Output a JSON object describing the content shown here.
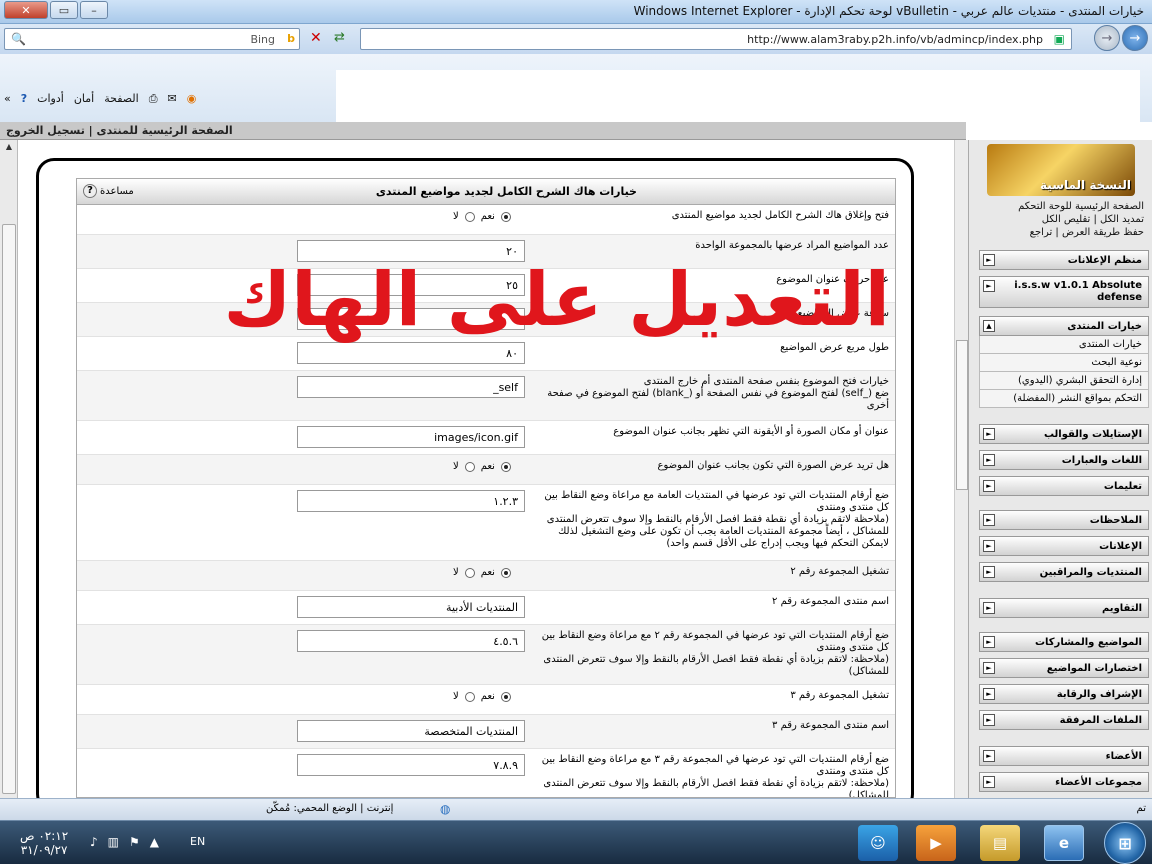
{
  "window": {
    "title": "خيارات المنتدى - منتديات عالم عربي - vBulletin لوحة تحكم الإدارة - Windows Internet Explorer"
  },
  "address": {
    "url": "http://www.alam3raby.p2h.info/vb/admincp/index.php",
    "search_provider": "Bing"
  },
  "toolbar": {
    "page_label": "الصفحة",
    "safety_label": "أمان",
    "tools_label": "أدوات"
  },
  "adminbar": {
    "home_label": "الصفحة الرئيسية للمنتدى",
    "separator": "|",
    "logout_label": "تسجيل الخروج"
  },
  "panel": {
    "title": "خيارات هاك الشرح الكامل لجديد مواضيع المنتدى",
    "help_label": "مساعدة",
    "yes_label": "نعم",
    "no_label": "لا",
    "rows": [
      {
        "label": "فتح وإغلاق هاك الشرح الكامل لجديد مواضيع المنتدى"
      },
      {
        "label": "عدد المواضيع المراد عرضها بالمجموعة الواحدة",
        "value": "٢٠"
      },
      {
        "label": "عدد حروف عنوان الموضوع",
        "value": "٢٥"
      },
      {
        "label": "سرعة عرض المواضيع",
        "value": "٢"
      },
      {
        "label": "طول مربع عرض المواضيع",
        "value": "٨٠"
      },
      {
        "label": "خيارات فتح الموضوع بنفس صفحة المنتدى أم خارج المنتدى",
        "help": "ضع (_self) لفتح الموضوع في نفس الصفحة أو (_blank) لفتح الموضوع في صفحة أخرى",
        "value": "_self"
      },
      {
        "label": "عنوان أو مكان الصورة أو الأيقونة التي تظهر بجانب عنوان الموضوع",
        "value": "images/icon.gif"
      },
      {
        "label": "هل تريد عرض الصورة التي تكون بجانب عنوان الموضوع"
      },
      {
        "label": "ضع أرقام المنتديات التي تود عرضها في المنتديات العامة مع مراعاة وضع النقاط بين كل منتدى ومنتدى",
        "help": "(ملاحظة لاتقم بزيادة أي نقطة فقط افصل الأرقام بالنقط وإلا سوف تتعرض المنتدى للمشاكل ، أيضاً مجموعة المنتديات العامة يجب أن تكون على وضع التشغيل لذلك لايمكن التحكم فيها ويجب إدراج على الأقل قسم واحد)",
        "value": "١.٢.٣"
      },
      {
        "label": "تشغيل المجموعة رقم ٢"
      },
      {
        "label": "اسم منتدى المجموعة رقم ٢",
        "value": "المنتديات الأدبية"
      },
      {
        "label": "ضع أرقام المنتديات التي تود عرضها في المجموعة رقم ٢ مع مراعاة وضع النقاط بين كل منتدى ومنتدى",
        "help": "(ملاحظة: لاتقم بزيادة أي نقطة فقط افصل الأرقام بالنقط وإلا سوف تتعرض المنتدى للمشاكل)",
        "value": "٤.٥.٦"
      },
      {
        "label": "تشغيل المجموعة رقم ٣"
      },
      {
        "label": "اسم منتدى المجموعة رقم ٣",
        "value": "المنتديات المتخصصة"
      },
      {
        "label": "ضع أرقام المنتديات التي تود عرضها في المجموعة رقم ٣ مع مراعاة وضع النقاط بين كل منتدى ومنتدى",
        "help": "(ملاحظة: لاتقم بزيادة أي نقطة فقط افصل الأرقام بالنقط وإلا سوف تتعرض المنتدى للمشاكل)",
        "value": "٧.٨.٩"
      }
    ]
  },
  "overlay": {
    "text": "التعديل على الهاك"
  },
  "nav": {
    "logo_text": "النسخة الماسية",
    "links": [
      "الصفحة الرئيسية للوحة التحكم",
      "تمديد الكل | تقليص الكل",
      "حفظ طريقة العرض | تراجع"
    ],
    "groups": [
      {
        "label": "منظم الإعلانات"
      },
      {
        "label": "i.s.s.w v1.0.1 Absolute defense"
      },
      {
        "label": "خيارات المنتدى",
        "subs": [
          "خيارات المنتدى",
          "نوعية البحث",
          "إدارة التحقق البشري (اليدوي)",
          "التحكم بمواقع النشر (المفضلة)"
        ]
      },
      {
        "label": "الإستايلات والقوالب"
      },
      {
        "label": "اللغات والعبارات"
      },
      {
        "label": "تعليمات"
      },
      {
        "label": "الملاحظات"
      },
      {
        "label": "الإعلانات"
      },
      {
        "label": "المنتديات والمراقبين"
      },
      {
        "label": "التقاويم"
      },
      {
        "label": "المواضيع والمشاركات"
      },
      {
        "label": "اختصارات المواضيع"
      },
      {
        "label": "الإشراف والرقابة"
      },
      {
        "label": "الملفات المرفقة"
      },
      {
        "label": "الأعضاء"
      },
      {
        "label": "مجموعات الأعضاء"
      }
    ]
  },
  "status": {
    "text": "إنترنت | الوضع المحمي: مُمكّن",
    "done": "تم"
  },
  "taskbar": {
    "time": "٠٢:١٢ ص",
    "date": "٣١/٠٩/٢٧",
    "lang": "EN"
  }
}
